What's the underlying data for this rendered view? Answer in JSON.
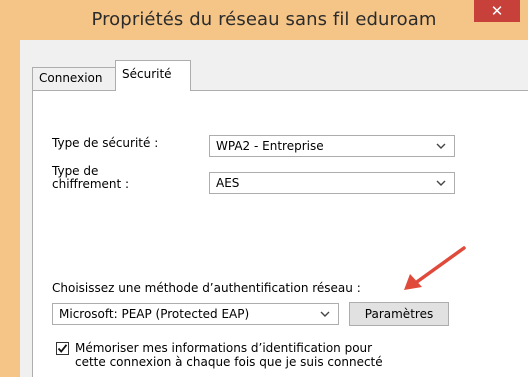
{
  "window": {
    "title": "Propriétés du réseau sans fil eduroam",
    "close_glyph": "✕"
  },
  "tabs": [
    {
      "label": "Connexion",
      "active": false
    },
    {
      "label": "Sécurité",
      "active": true
    }
  ],
  "security": {
    "type_label": "Type de sécurité :",
    "type_value": "WPA2 - Entreprise",
    "encryption_label_line1": "Type de",
    "encryption_label_line2": "chiffrement :",
    "encryption_value": "AES"
  },
  "auth": {
    "method_label": "Choisissez une méthode d’authentification réseau :",
    "method_value": "Microsoft: PEAP (Protected EAP)",
    "settings_button": "Paramètres"
  },
  "remember": {
    "checked": true,
    "line1": "Mémoriser mes informations d’identification pour",
    "line2": "cette connexion à chaque fois que je suis connecté"
  },
  "colors": {
    "titlebar": "#f5c588",
    "close": "#c7403a",
    "arrow": "#e04a3a"
  },
  "icons": {
    "close": "close-icon",
    "dropdown": "chevron-down-icon",
    "check": "checkmark-icon",
    "arrow": "red-arrow-annotation"
  }
}
